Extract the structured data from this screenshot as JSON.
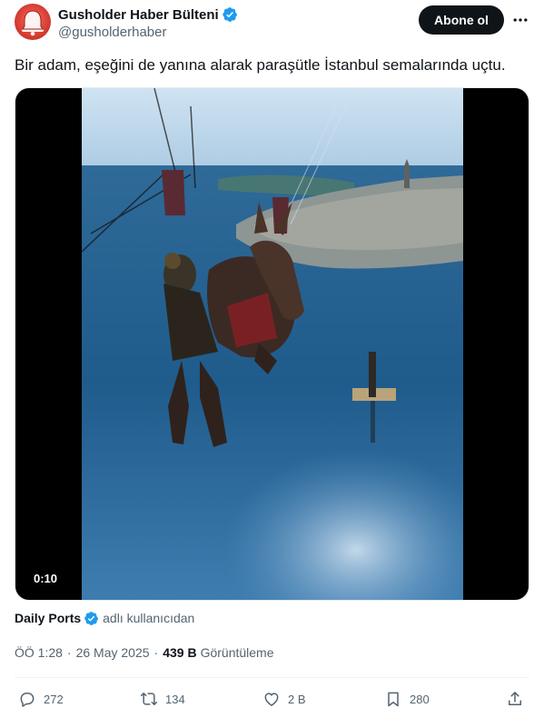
{
  "author": {
    "display_name": "Gusholder Haber Bülteni",
    "handle": "@gusholderhaber"
  },
  "follow_label": "Abone ol",
  "tweet_text": "Bir adam, eşeğini de yanına alarak paraşütle İstanbul semalarında uçtu.",
  "video": {
    "duration": "0:10"
  },
  "source": {
    "name": "Daily Ports",
    "suffix": "adlı kullanıcıdan"
  },
  "meta": {
    "time": "ÖÖ 1:28",
    "separator": "·",
    "date": "26 May 2025",
    "views_count": "439 B",
    "views_label": "Görüntüleme"
  },
  "actions": {
    "replies": "272",
    "reposts": "134",
    "likes": "2 B",
    "bookmarks": "280"
  },
  "colors": {
    "accent": "#1d9bf0",
    "text": "#0f1419",
    "muted": "#536471",
    "button": "#0f1419"
  }
}
